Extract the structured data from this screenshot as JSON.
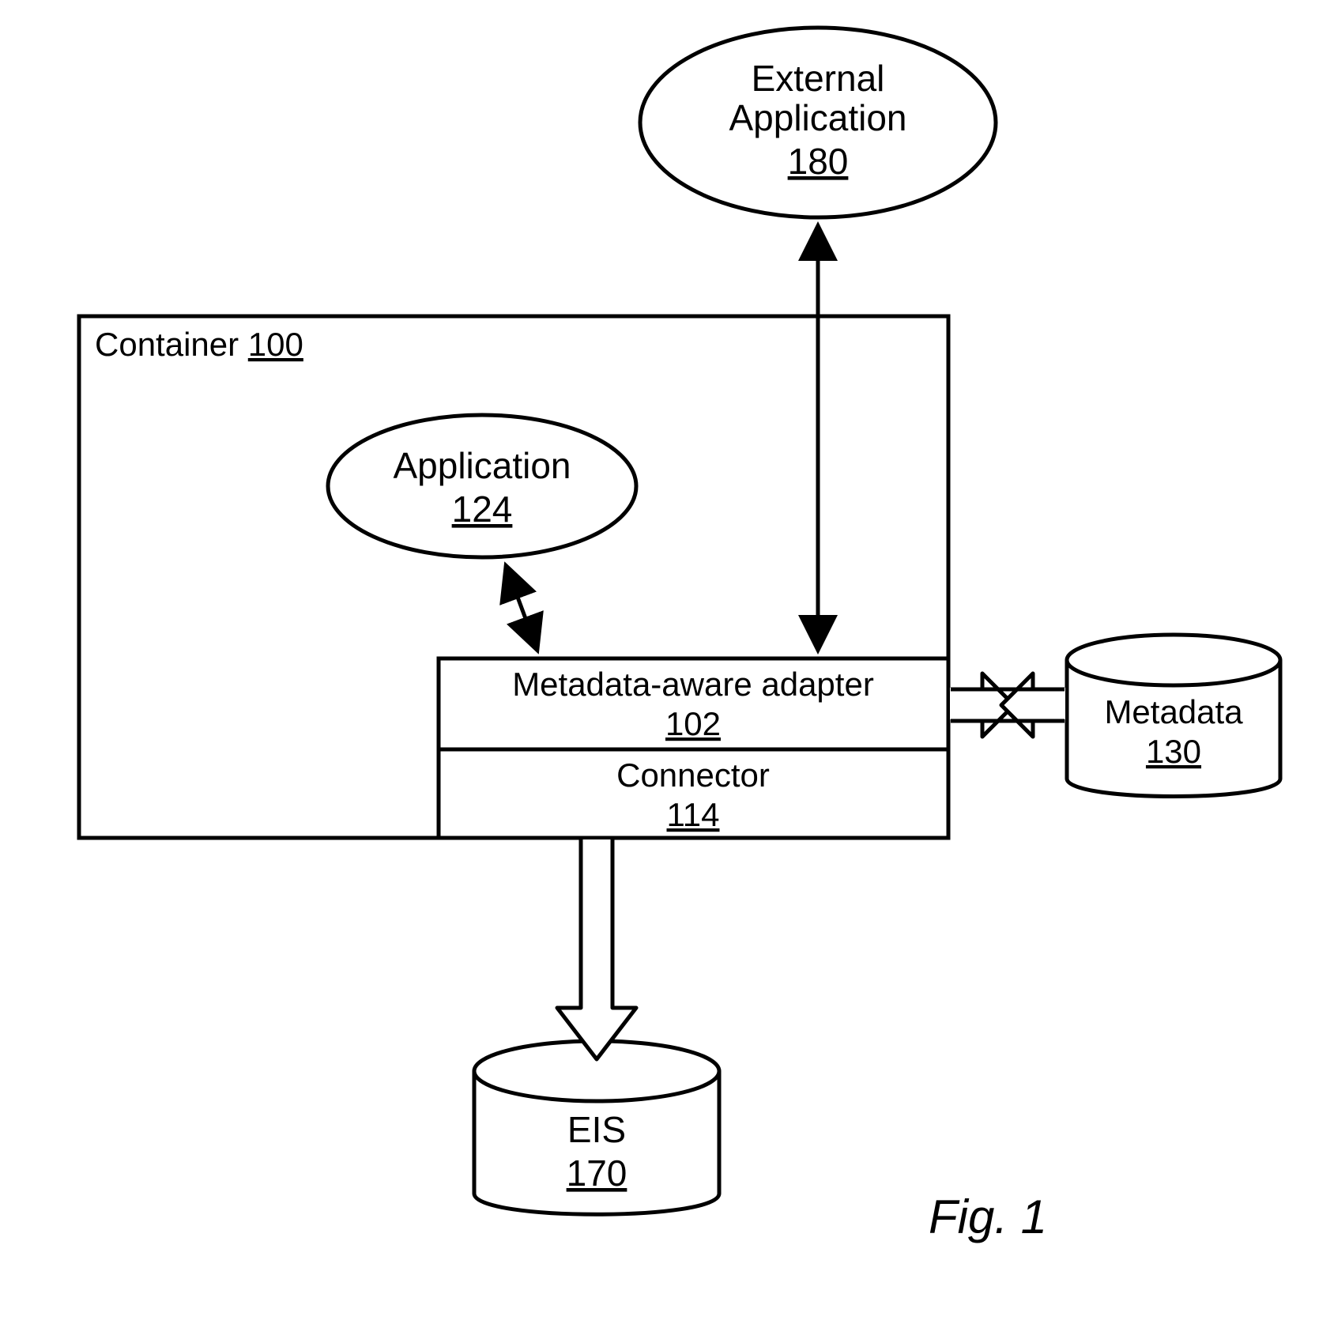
{
  "figure_caption": "Fig. 1",
  "container": {
    "label": "Container",
    "ref": "100"
  },
  "external_app": {
    "label_line1": "External",
    "label_line2": "Application",
    "ref": "180"
  },
  "application": {
    "label": "Application",
    "ref": "124"
  },
  "adapter": {
    "label": "Metadata-aware adapter",
    "ref": "102"
  },
  "connector": {
    "label": "Connector",
    "ref": "114"
  },
  "metadata_db": {
    "label": "Metadata",
    "ref": "130"
  },
  "eis_db": {
    "label": "EIS",
    "ref": "170"
  }
}
